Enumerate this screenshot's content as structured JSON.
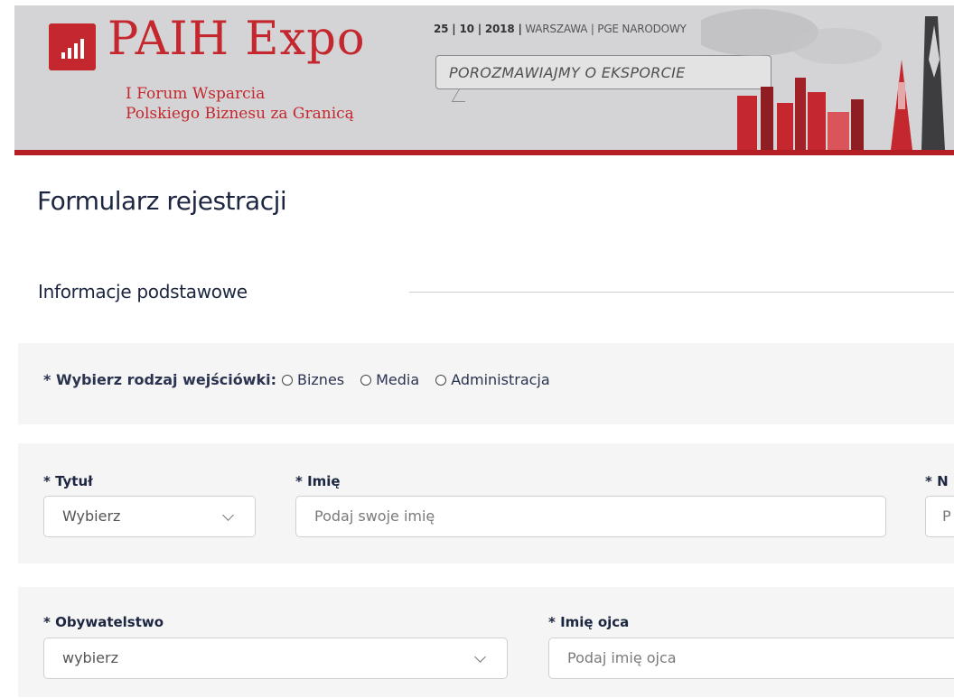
{
  "banner": {
    "logo_title": "PAIH Expo",
    "logo_sub_line1": "I Forum Wsparcia",
    "logo_sub_line2": "Polskiego Biznesu za Granicą",
    "event_date_bold": "25 | 10 | 2018 |",
    "event_place": " WARSZAWA | PGE NARODOWY",
    "slogan": "POROZMAWIAJMY O EKSPORCIE",
    "colors": {
      "brand_red": "#c4272d",
      "banner_bg": "#d4d4d6"
    },
    "logo_icon": "bar-chart-icon"
  },
  "page": {
    "title": "Formularz rejestracji",
    "section_title": "Informacje podstawowe"
  },
  "ticket": {
    "label": "* Wybierz rodzaj wejściówki:",
    "options": [
      "Biznes",
      "Media",
      "Administracja"
    ]
  },
  "row1": {
    "title_label": "* Tytuł",
    "title_value": "Wybierz",
    "first_name_label": "* Imię",
    "first_name_placeholder": "Podaj swoje imię",
    "cut_label": "* N",
    "cut_placeholder": "P"
  },
  "row2": {
    "citizenship_label": "* Obywatelstwo",
    "citizenship_value": "wybierz",
    "father_name_label": "* Imię ojca",
    "father_name_placeholder": "Podaj imię ojca"
  }
}
